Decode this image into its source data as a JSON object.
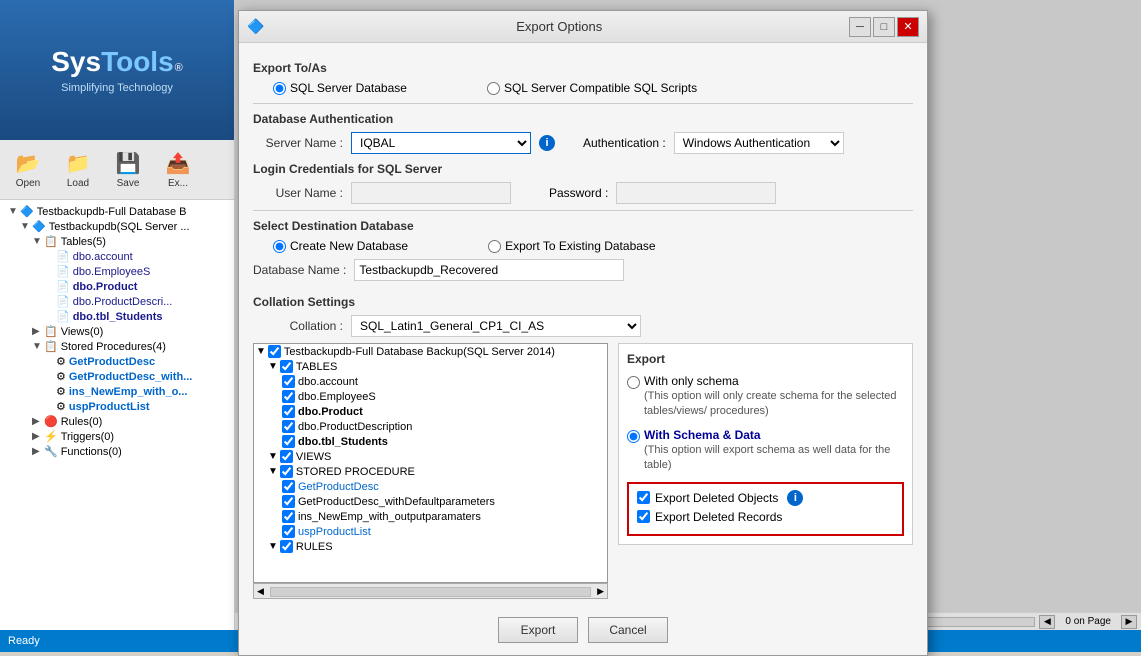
{
  "app": {
    "title": "SysTools",
    "tagline": "Simplifying Technology",
    "status": "Ready"
  },
  "toolbar": {
    "buttons": [
      {
        "label": "Open",
        "icon": "📂"
      },
      {
        "label": "Load",
        "icon": "📁"
      },
      {
        "label": "Save",
        "icon": "💾"
      },
      {
        "label": "Ex...",
        "icon": "📤"
      }
    ]
  },
  "sidebar_tree": {
    "items": [
      {
        "indent": 1,
        "expand": "▼",
        "icon": "🔷",
        "text": "Testbackupdb-Full Database B",
        "style": "normal"
      },
      {
        "indent": 2,
        "expand": "▼",
        "icon": "🔷",
        "text": "Testbackupdb(SQL Server ...",
        "style": "normal"
      },
      {
        "indent": 3,
        "expand": "▼",
        "icon": "📋",
        "text": "Tables(5)",
        "style": "normal"
      },
      {
        "indent": 4,
        "expand": "",
        "icon": "📄",
        "text": "dbo.account",
        "style": "navy"
      },
      {
        "indent": 4,
        "expand": "",
        "icon": "📄",
        "text": "dbo.EmployeeS",
        "style": "navy"
      },
      {
        "indent": 4,
        "expand": "",
        "icon": "📄",
        "text": "dbo.Product",
        "style": "navy"
      },
      {
        "indent": 4,
        "expand": "",
        "icon": "📄",
        "text": "dbo.ProductDescri...",
        "style": "navy"
      },
      {
        "indent": 4,
        "expand": "",
        "icon": "📄",
        "text": "dbo.tbl_Students",
        "style": "navy"
      },
      {
        "indent": 3,
        "expand": "▶",
        "icon": "📋",
        "text": "Views(0)",
        "style": "normal"
      },
      {
        "indent": 3,
        "expand": "▼",
        "icon": "📋",
        "text": "Stored Procedures(4)",
        "style": "normal"
      },
      {
        "indent": 4,
        "expand": "",
        "icon": "⚙",
        "text": "GetProductDesc",
        "style": "blue"
      },
      {
        "indent": 4,
        "expand": "",
        "icon": "⚙",
        "text": "GetProductDesc_with...",
        "style": "blue"
      },
      {
        "indent": 4,
        "expand": "",
        "icon": "⚙",
        "text": "ins_NewEmp_with_o...",
        "style": "blue"
      },
      {
        "indent": 4,
        "expand": "",
        "icon": "⚙",
        "text": "uspProductList",
        "style": "blue"
      },
      {
        "indent": 3,
        "expand": "▶",
        "icon": "🔴",
        "text": "Rules(0)",
        "style": "normal"
      },
      {
        "indent": 3,
        "expand": "▶",
        "icon": "⚡",
        "text": "Triggers(0)",
        "style": "normal"
      },
      {
        "indent": 3,
        "expand": "▶",
        "icon": "🔧",
        "text": "Functions(0)",
        "style": "normal"
      }
    ]
  },
  "dialog": {
    "title": "Export Options",
    "export_toas_label": "Export To/As",
    "radio_sql_server": "SQL Server Database",
    "radio_sql_scripts": "SQL Server Compatible SQL Scripts",
    "db_auth_label": "Database Authentication",
    "server_name_label": "Server Name :",
    "server_name_value": "IQBAL",
    "auth_label": "Authentication :",
    "auth_value": "Windows Authentication",
    "login_creds_label": "Login Credentials for SQL Server",
    "username_label": "User Name :",
    "username_value": "",
    "password_label": "Password :",
    "password_value": "",
    "select_dest_label": "Select Destination Database",
    "radio_create_new": "Create New Database",
    "radio_export_existing": "Export To Existing Database",
    "db_name_label": "Database Name :",
    "db_name_value": "Testbackupdb_Recovered",
    "collation_label": "Collation Settings",
    "collation_sub_label": "Collation :",
    "collation_value": "SQL_Latin1_General_CP1_CI_AS",
    "export_label": "Export",
    "radio_schema_only": "With only schema",
    "schema_only_desc": "(This option will only create schema for the  selected tables/views/ procedures)",
    "radio_schema_data": "With Schema & Data",
    "schema_data_desc": "(This option will export schema as well data for the table)",
    "export_deleted_objects_label": "Export Deleted Objects",
    "export_deleted_records_label": "Export Deleted Records",
    "export_btn": "Export",
    "cancel_btn": "Cancel",
    "dialog_tree_root": "Testbackupdb-Full Database Backup(SQL Server 2014)",
    "tree_tables": "TABLES",
    "tree_account": "dbo.account",
    "tree_employees": "dbo.EmployeeS",
    "tree_product": "dbo.Product",
    "tree_productdesc": "dbo.ProductDescription",
    "tree_students": "dbo.tbl_Students",
    "tree_views": "VIEWS",
    "tree_stored_proc": "STORED PROCEDURE",
    "tree_sp1": "GetProductDesc",
    "tree_sp2": "GetProductDesc_withDefaultparameters",
    "tree_sp3": "ins_NewEmp_with_outputparamaters",
    "tree_sp4": "uspProductList",
    "tree_rules": "RULES",
    "page_nav": "0  on Page"
  },
  "colors": {
    "accent_blue": "#0066cc",
    "header_blue": "#2b6cb0",
    "error_red": "#cc0000",
    "checked_blue": "#0066cc"
  }
}
